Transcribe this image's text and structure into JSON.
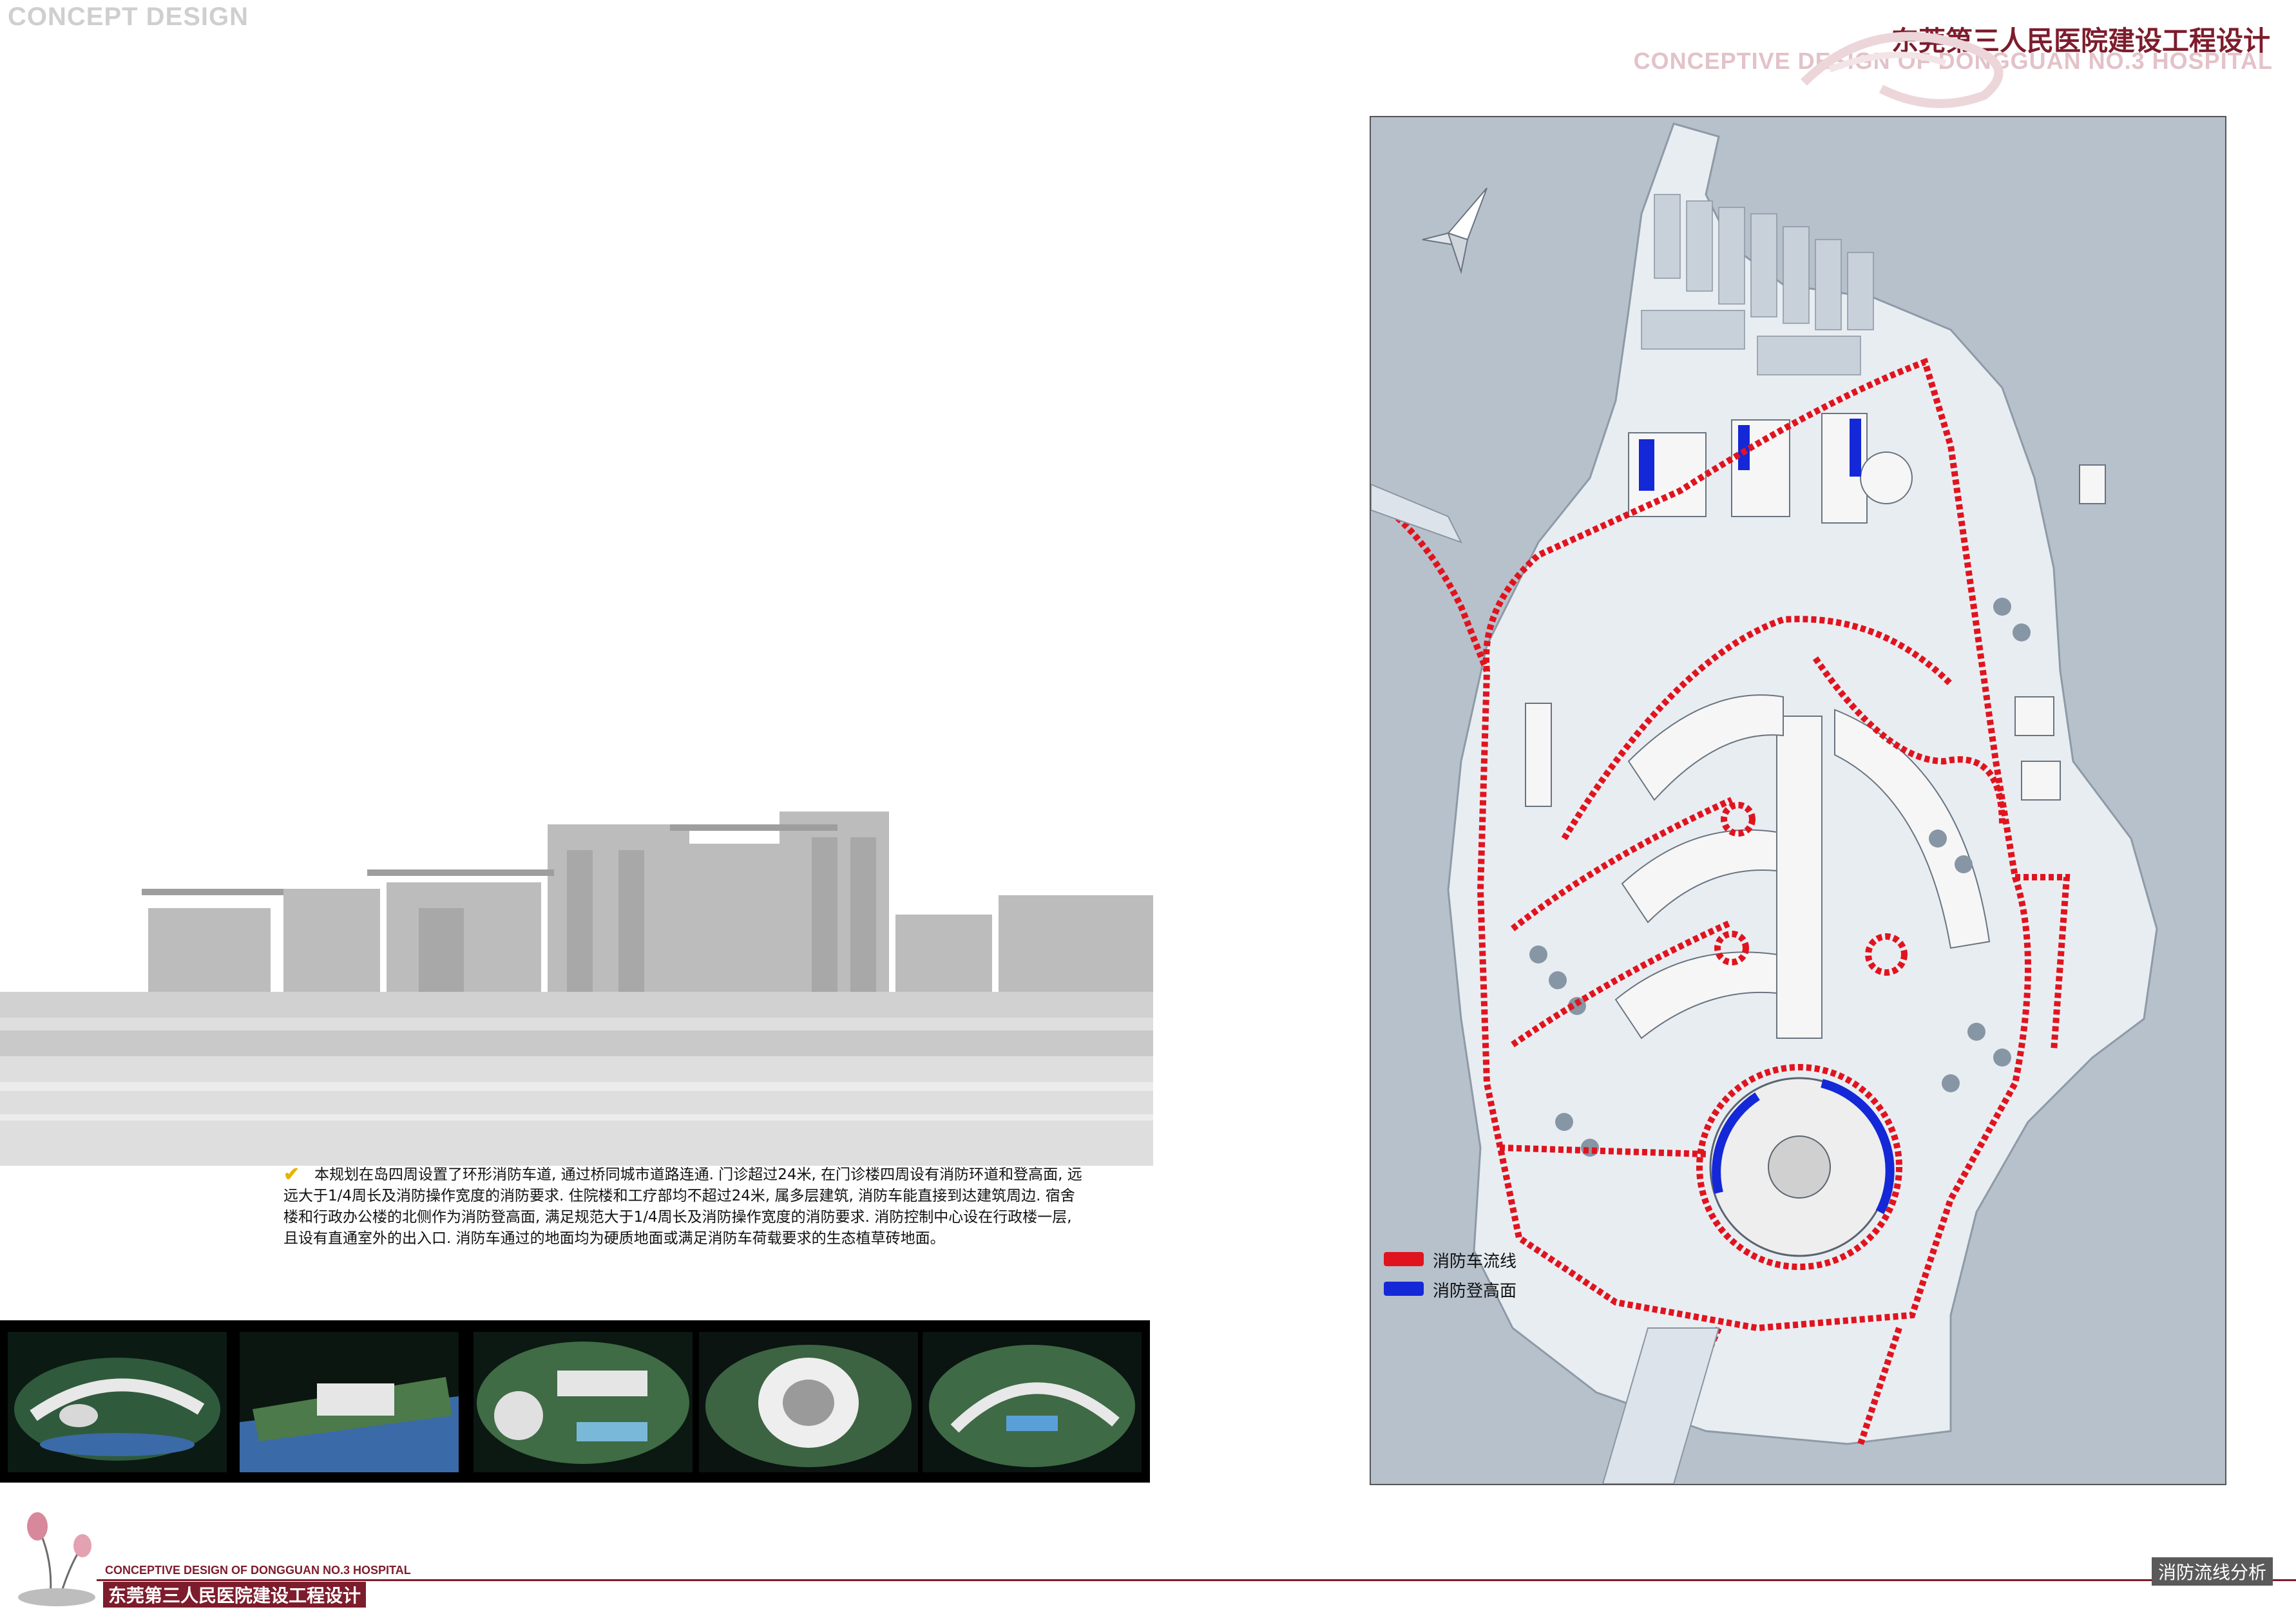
{
  "header": {
    "concept_tag": "CONCEPT DESIGN",
    "title_cn": "东莞第三人民医院建设工程设计",
    "title_en": "CONCEPTIVE DESIGN OF DONGGUAN NO.3 HOSPITAL"
  },
  "description": "本规划在岛四周设置了环形消防车道, 通过桥同城市道路连通. 门诊超过24米, 在门诊楼四周设有消防环道和登高面, 远远大于1/4周长及消防操作宽度的消防要求. 住院楼和工疗部均不超过24米, 属多层建筑, 消防车能直接到达建筑周边. 宿舍楼和行政办公楼的北侧作为消防登高面, 满足规范大于1/4周长及消防操作宽度的消防要求. 消防控制中心设在行政楼一层, 且设有直通室外的出入口. 消防车通过的地面均为硬质地面或满足消防车荷载要求的生态植草砖地面。",
  "legend": [
    {
      "label": "消防车流线",
      "color": "#e0141e"
    },
    {
      "label": "消防登高面",
      "color": "#1428d8"
    }
  ],
  "footer": {
    "title_en": "CONCEPTIVE DESIGN OF DONGGUAN NO.3 HOSPITAL",
    "title_cn": "东莞第三人民医院建设工程设计",
    "page_label": "消防流线分析"
  },
  "colors": {
    "brand": "#7d1c2c",
    "fire_route": "#e0141e",
    "fire_climb": "#1428d8",
    "water": "#b6c1cc",
    "island": "#e8edf2"
  },
  "icons": [
    "checkmark-icon",
    "north-arrow-icon",
    "lotus-logo"
  ]
}
